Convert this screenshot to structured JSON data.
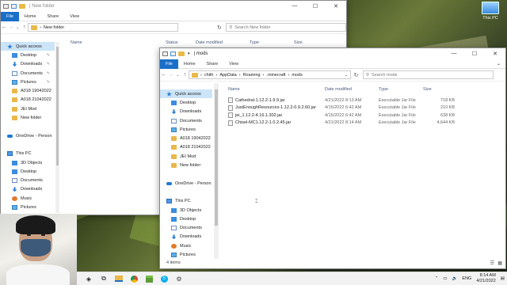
{
  "desktop": {
    "this_pc_label": "This PC"
  },
  "back_window": {
    "title": "New folder",
    "tabs": [
      "File",
      "Home",
      "Share",
      "View"
    ],
    "path": "New folder",
    "search_placeholder": "Search New folder",
    "columns": [
      "Name",
      "Status",
      "Date modified",
      "Type",
      "Size"
    ],
    "nav": [
      {
        "label": "Quick access",
        "icon": "star-icon",
        "pin": false,
        "sel": true
      },
      {
        "label": "Desktop",
        "icon": "folder-blue-icon",
        "pin": true
      },
      {
        "label": "Downloads",
        "icon": "download-icon",
        "pin": true
      },
      {
        "label": "Documents",
        "icon": "document-icon",
        "pin": true
      },
      {
        "label": "Pictures",
        "icon": "picture-icon",
        "pin": true
      },
      {
        "label": "A018 19042022",
        "icon": "folder-icon",
        "pin": false
      },
      {
        "label": "A018 21042022",
        "icon": "folder-icon",
        "pin": false
      },
      {
        "label": "JEI Mod",
        "icon": "folder-icon",
        "pin": false
      },
      {
        "label": "New folder",
        "icon": "folder-icon",
        "pin": false
      },
      {
        "label": "",
        "icon": "",
        "pin": false
      },
      {
        "label": "OneDrive - Person",
        "icon": "cloud-icon",
        "pin": false
      },
      {
        "label": "",
        "icon": "",
        "pin": false
      },
      {
        "label": "This PC",
        "icon": "pc-icon",
        "pin": false
      },
      {
        "label": "3D Objects",
        "icon": "folder-blue-icon",
        "pin": false
      },
      {
        "label": "Desktop",
        "icon": "folder-blue-icon",
        "pin": false
      },
      {
        "label": "Documents",
        "icon": "document-icon",
        "pin": false
      },
      {
        "label": "Downloads",
        "icon": "download-icon",
        "pin": false
      },
      {
        "label": "Music",
        "icon": "music-icon",
        "pin": false
      },
      {
        "label": "Pictures",
        "icon": "picture-icon",
        "pin": false
      },
      {
        "label": "Videos",
        "icon": "video-icon",
        "pin": false
      }
    ]
  },
  "front_window": {
    "title": "mods",
    "tabs": [
      "File",
      "Home",
      "Share",
      "View"
    ],
    "breadcrumb": [
      "chith",
      "AppData",
      "Roaming",
      ".minecraft",
      "mods"
    ],
    "search_placeholder": "Search mods",
    "columns": [
      "Name",
      "Date modified",
      "Type",
      "Size"
    ],
    "files": [
      {
        "name": "Cathedral-1.12.2-1.9.9.jar",
        "date": "4/21/2022 8:13 AM",
        "type": "Executable Jar File",
        "size": "718 KB"
      },
      {
        "name": "JustEnoughResources-1.12.2-0.9.2.60.jar",
        "date": "4/15/2022 6:42 AM",
        "type": "Executable Jar File",
        "size": "210 KB"
      },
      {
        "name": "jei_1.12.2-4.16.1.302.jar",
        "date": "4/15/2022 6:42 AM",
        "type": "Executable Jar File",
        "size": "638 KB"
      },
      {
        "name": "Chisel-MC1.12.2-1.0.2.45.jar",
        "date": "4/21/2022 8:14 AM",
        "type": "Executable Jar File",
        "size": "4,644 KB"
      }
    ],
    "nav": [
      {
        "label": "Quick access",
        "icon": "star-icon",
        "sel": true
      },
      {
        "label": "Desktop",
        "icon": "folder-blue-icon"
      },
      {
        "label": "Downloads",
        "icon": "download-icon"
      },
      {
        "label": "Documents",
        "icon": "document-icon"
      },
      {
        "label": "Pictures",
        "icon": "picture-icon"
      },
      {
        "label": "A018 19042022",
        "icon": "folder-icon"
      },
      {
        "label": "A018 21042022",
        "icon": "folder-icon"
      },
      {
        "label": "JEI Mod",
        "icon": "folder-icon"
      },
      {
        "label": "New folder",
        "icon": "folder-icon"
      },
      {
        "label": "",
        "icon": ""
      },
      {
        "label": "OneDrive - Person",
        "icon": "cloud-icon"
      },
      {
        "label": "",
        "icon": ""
      },
      {
        "label": "This PC",
        "icon": "pc-icon"
      },
      {
        "label": "3D Objects",
        "icon": "folder-blue-icon"
      },
      {
        "label": "Desktop",
        "icon": "folder-blue-icon"
      },
      {
        "label": "Documents",
        "icon": "document-icon"
      },
      {
        "label": "Downloads",
        "icon": "download-icon"
      },
      {
        "label": "Music",
        "icon": "music-icon"
      },
      {
        "label": "Pictures",
        "icon": "picture-icon"
      },
      {
        "label": "Videos",
        "icon": "video-icon"
      }
    ],
    "status": "4 items"
  },
  "taskbar": {
    "apps": [
      "start-icon",
      "task-view-icon",
      "file-explorer-icon",
      "chrome-icon",
      "minecraft-icon",
      "skype-icon",
      "settings-icon"
    ],
    "lang": "ENG",
    "time": "8:14 AM",
    "date": "4/21/2022"
  }
}
